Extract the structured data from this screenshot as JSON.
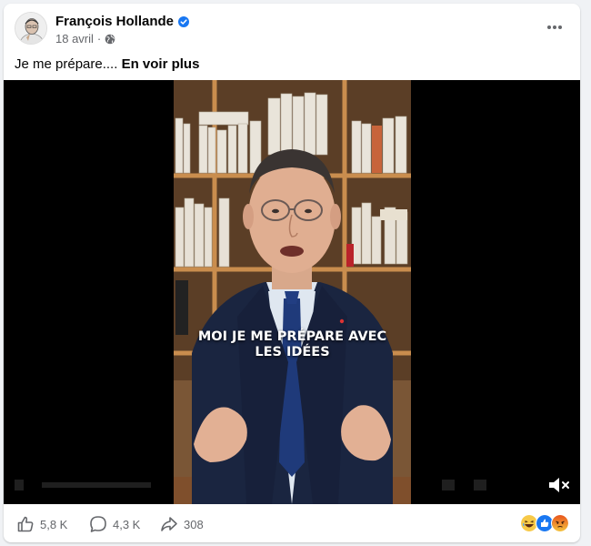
{
  "post": {
    "author": "François Hollande",
    "date": "18 avril",
    "separator": "·",
    "caption_text": "Je me prépare....",
    "see_more": "En voir plus"
  },
  "video": {
    "subtitle_line1": "MOI JE ME PRÉPARE AVEC",
    "subtitle_line2": "LES IDÉES",
    "muted": true
  },
  "footer": {
    "likes": "5,8 K",
    "comments": "4,3 K",
    "shares": "308",
    "reactions": [
      "laugh-icon",
      "like-icon",
      "angry-icon"
    ]
  },
  "colors": {
    "verified": "#1877f2",
    "meta_text": "#65676b",
    "card_bg": "#ffffff",
    "page_bg": "#f0f2f5"
  }
}
